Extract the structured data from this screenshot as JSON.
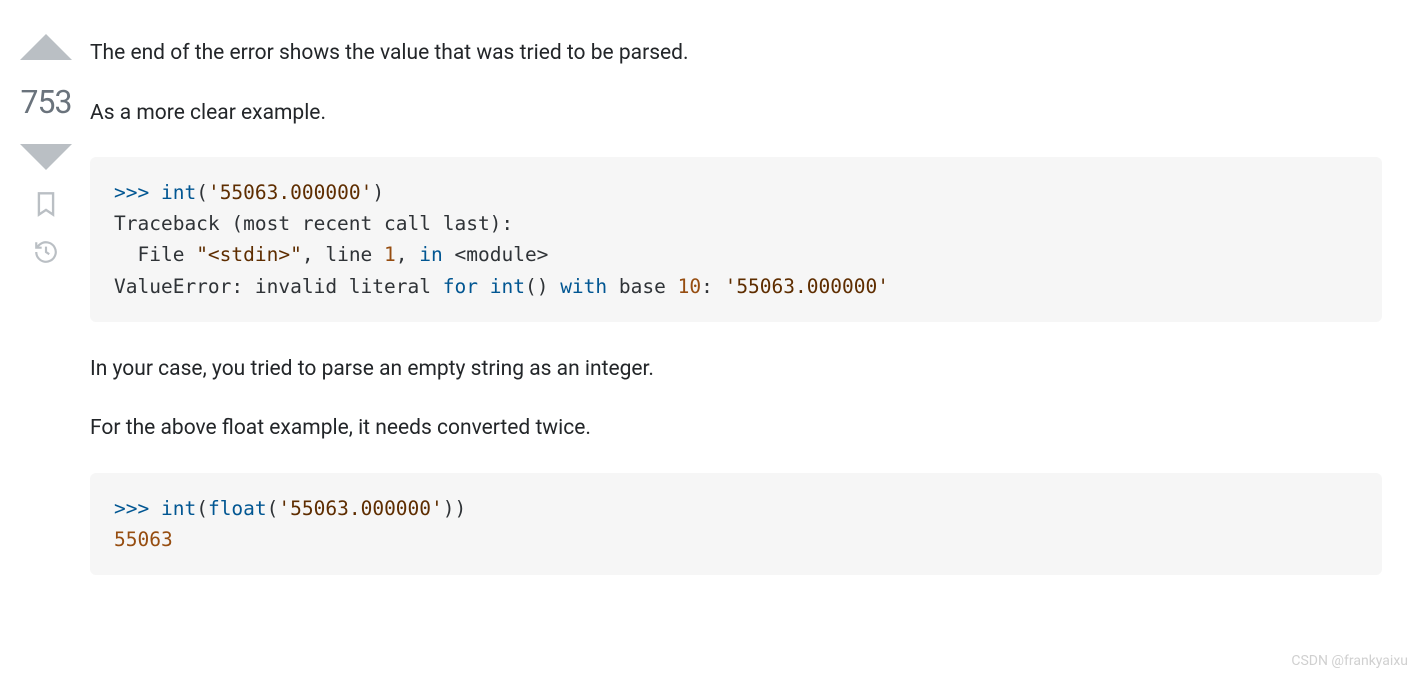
{
  "vote": {
    "score": "753"
  },
  "paragraphs": {
    "p1": "The end of the error shows the value that was tried to be parsed.",
    "p2": "As a more clear example.",
    "p3": "In your case, you tried to parse an empty string as an integer.",
    "p4": "For the above float example, it needs converted twice."
  },
  "code1": {
    "prompt1": ">>> ",
    "fn_int": "int",
    "open": "(",
    "str1": "'55063.000000'",
    "close": ")",
    "traceback_l1": "Traceback (most recent call last):",
    "file_pre": "  File ",
    "file_str": "\"<stdin>\"",
    "file_mid": ", line ",
    "file_lineno": "1",
    "file_comma": ", ",
    "kw_in": "in",
    "module": " <module>",
    "err_pre": "ValueError: invalid literal ",
    "kw_for": "for",
    "mid1": " ",
    "fn_int2": "int",
    "parens": "() ",
    "kw_with": "with",
    "base_txt": " base ",
    "base_num": "10",
    "colon": ": ",
    "err_str": "'55063.000000'"
  },
  "code2": {
    "prompt1": ">>> ",
    "fn_int": "int",
    "open1": "(",
    "fn_float": "float",
    "open2": "(",
    "str1": "'55063.000000'",
    "close": "))",
    "result": "55063"
  },
  "watermark": "CSDN @frankyaixu"
}
